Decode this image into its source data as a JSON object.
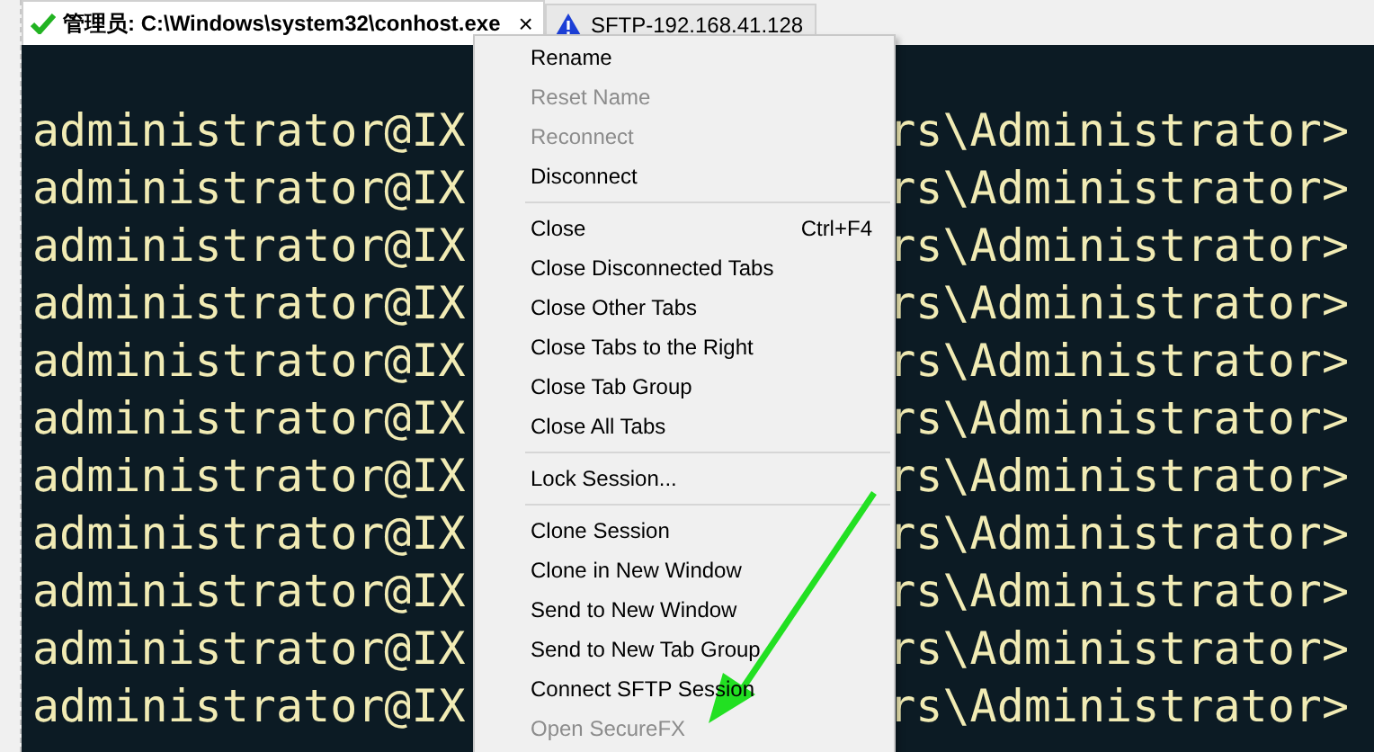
{
  "tabs": [
    {
      "label": "管理员: C:\\Windows\\system32\\conhost.exe",
      "kind": "connected",
      "selected": true,
      "close": "×"
    },
    {
      "label": "SFTP-192.168.41.128",
      "kind": "warning",
      "selected": false
    }
  ],
  "terminal": {
    "lines": [
      {
        "left": "administrator@IX",
        "right": "rs\\Administrator>"
      },
      {
        "left": "administrator@IX",
        "right": "rs\\Administrator>"
      },
      {
        "left": "administrator@IX",
        "right": "rs\\Administrator>"
      },
      {
        "left": "administrator@IX",
        "right": "rs\\Administrator>"
      },
      {
        "left": "administrator@IX",
        "right": "rs\\Administrator>"
      },
      {
        "left": "administrator@IX",
        "right": "rs\\Administrator>"
      },
      {
        "left": "administrator@IX",
        "right": "rs\\Administrator>"
      },
      {
        "left": "administrator@IX",
        "right": "rs\\Administrator>"
      },
      {
        "left": "administrator@IX",
        "right": "rs\\Administrator>"
      },
      {
        "left": "administrator@IX",
        "right": "rs\\Administrator>"
      },
      {
        "left": "administrator@IX",
        "right": "rs\\Administrator>"
      }
    ]
  },
  "context_menu": {
    "groups": [
      [
        {
          "label": "Rename",
          "disabled": false
        },
        {
          "label": "Reset Name",
          "disabled": true
        },
        {
          "label": "Reconnect",
          "disabled": true
        },
        {
          "label": "Disconnect",
          "disabled": false
        }
      ],
      [
        {
          "label": "Close",
          "shortcut": "Ctrl+F4",
          "disabled": false
        },
        {
          "label": "Close Disconnected Tabs",
          "disabled": false
        },
        {
          "label": "Close Other Tabs",
          "disabled": false
        },
        {
          "label": "Close Tabs to the Right",
          "disabled": false
        },
        {
          "label": "Close Tab Group",
          "disabled": false
        },
        {
          "label": "Close All Tabs",
          "disabled": false
        }
      ],
      [
        {
          "label": "Lock Session...",
          "disabled": false
        }
      ],
      [
        {
          "label": "Clone Session",
          "disabled": false
        },
        {
          "label": "Clone in New Window",
          "disabled": false
        },
        {
          "label": "Send to New Window",
          "disabled": false
        },
        {
          "label": "Send to New Tab Group",
          "disabled": false
        },
        {
          "label": "Connect SFTP Session",
          "disabled": false
        },
        {
          "label": "Open SecureFX",
          "disabled": true
        }
      ]
    ]
  }
}
